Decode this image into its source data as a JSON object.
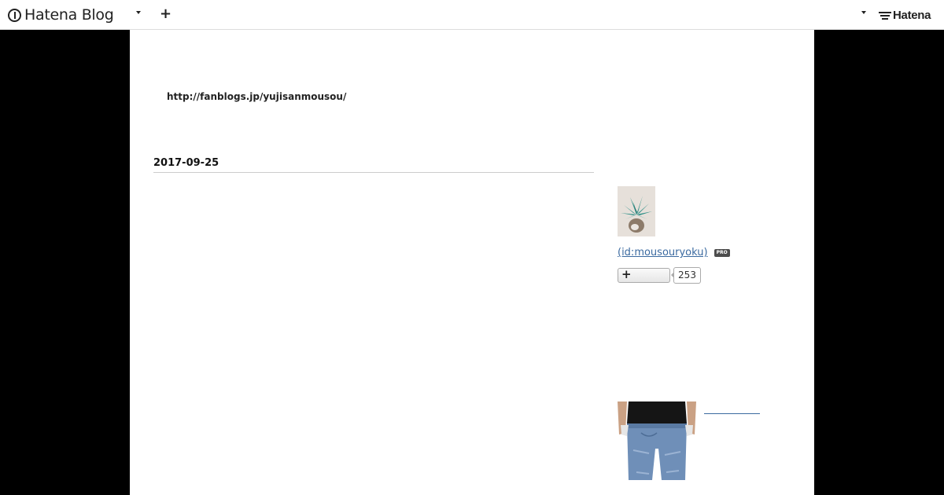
{
  "header": {
    "logo_text": "Hatena Blog",
    "add_icon": "plus-icon",
    "brand_text": "Hatena"
  },
  "blog": {
    "url_text": "http://fanblogs.jp/yujisanmousou/"
  },
  "entry": {
    "date": "2017-09-25"
  },
  "sidebar": {
    "author_link": "(id:mousouryoku)",
    "pro_badge": "PRO",
    "subscribe_icon": "plus-icon",
    "subscriber_count": "253"
  },
  "colors": {
    "link": "#3b6aa0",
    "page_background": "#000000",
    "content_background": "#ffffff"
  }
}
